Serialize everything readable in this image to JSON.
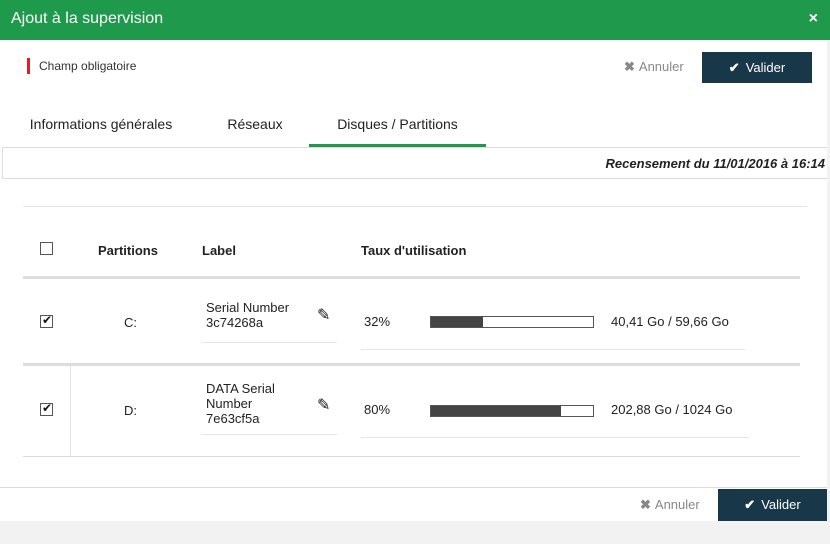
{
  "dialog": {
    "title": "Ajout à la supervision",
    "close_icon": "×"
  },
  "required_note": "Champ obligatoire",
  "buttons": {
    "cancel": "Annuler",
    "validate": "Valider"
  },
  "tabs": [
    {
      "label": "Informations générales",
      "active": false
    },
    {
      "label": "Réseaux",
      "active": false
    },
    {
      "label": "Disques / Partitions",
      "active": true
    }
  ],
  "census": "Recensement du 11/01/2016 à 16:14",
  "table": {
    "headers": {
      "partitions": "Partitions",
      "label": "Label",
      "usage": "Taux d'utilisation"
    },
    "rows": [
      {
        "checked": true,
        "partition": "C:",
        "label_lines": [
          "Serial Number",
          "3c74268a"
        ],
        "percent": "32%",
        "usage_fraction": 0.32,
        "size": "40,41 Go / 59,66 Go"
      },
      {
        "checked": true,
        "partition": "D:",
        "label_lines": [
          "DATA Serial",
          "Number",
          "7e63cf5a"
        ],
        "percent": "80%",
        "usage_fraction": 0.8,
        "size": "202,88 Go / 1024 Go"
      }
    ]
  },
  "colors": {
    "header_green": "#1f9a4c",
    "validate_bg": "#18384a",
    "required_red": "#e02020"
  }
}
